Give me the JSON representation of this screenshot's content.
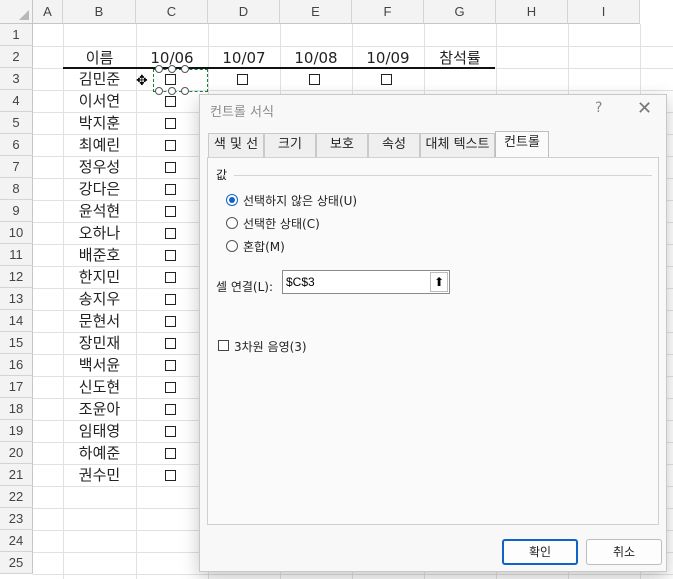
{
  "sheet": {
    "columns": [
      "A",
      "B",
      "C",
      "D",
      "E",
      "F",
      "G",
      "H",
      "I"
    ],
    "rows": [
      "1",
      "2",
      "3",
      "4",
      "5",
      "6",
      "7",
      "8",
      "9",
      "10",
      "11",
      "12",
      "13",
      "14",
      "15",
      "16",
      "17",
      "18",
      "19",
      "20",
      "21",
      "22",
      "23",
      "24",
      "25"
    ],
    "headers": [
      "이름",
      "10/06",
      "10/07",
      "10/08",
      "10/09",
      "참석률"
    ],
    "names": [
      "김민준",
      "이서연",
      "박지훈",
      "최예린",
      "정우성",
      "강다은",
      "윤석현",
      "오하나",
      "배준호",
      "한지민",
      "송지우",
      "문현서",
      "장민재",
      "백서윤",
      "신도현",
      "조윤아",
      "임태영",
      "하예준",
      "권수민"
    ]
  },
  "dialog": {
    "title": "컨트롤 서식",
    "help": "?",
    "close": "✕",
    "tabs": [
      "색 및 선",
      "크기",
      "보호",
      "속성",
      "대체 텍스트",
      "컨트롤"
    ],
    "active_tab": "컨트롤",
    "group_label": "값",
    "options": [
      "선택하지 않은 상태(U)",
      "선택한 상태(C)",
      "혼합(M)"
    ],
    "selected_option": "선택하지 않은 상태(U)",
    "cell_link_label": "셀 연결(L):",
    "cell_link_value": "$C$3",
    "shading_label": "3차원 음영(3)",
    "shading_checked": false,
    "ok": "확인",
    "cancel": "취소"
  },
  "colors": {
    "accent": "#0f62c6",
    "selection": "#1a7f37"
  }
}
